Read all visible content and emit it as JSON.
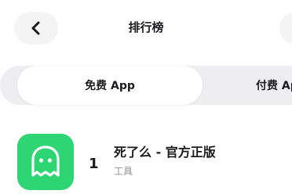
{
  "header": {
    "title": "排行榜",
    "back_icon": "chevron-left-icon"
  },
  "tabs": [
    {
      "label": "免费 App",
      "selected": true
    },
    {
      "label": "付费 App",
      "selected": false
    }
  ],
  "apps": [
    {
      "rank": "1",
      "name": "死了么 - 官方正版",
      "category": "工具",
      "icon": "ghost-icon",
      "icon_color": "#2ed573"
    }
  ]
}
